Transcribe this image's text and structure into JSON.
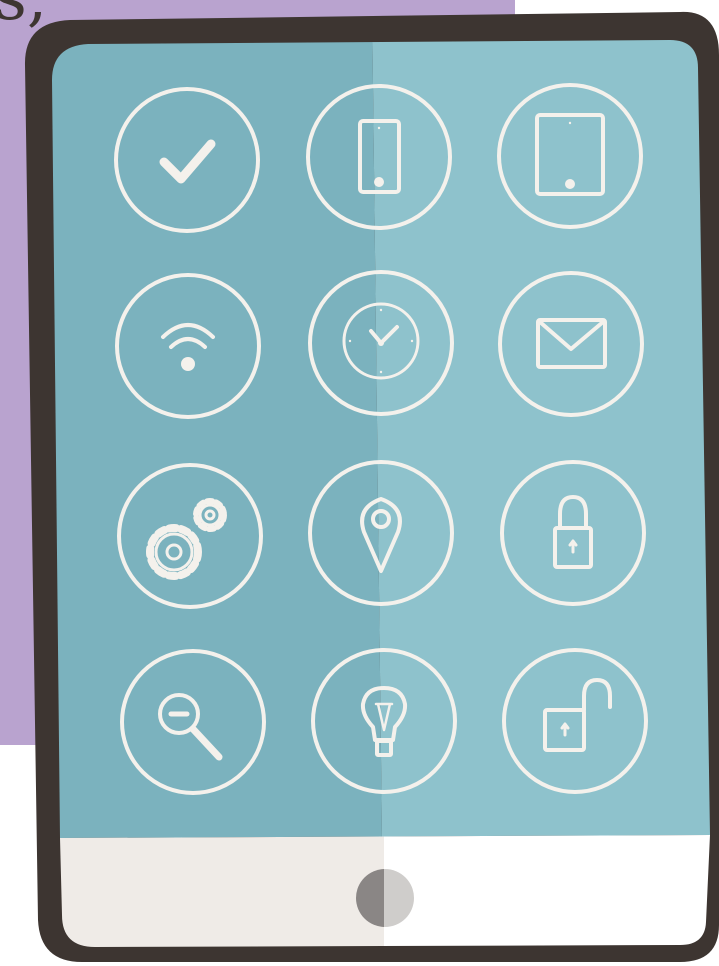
{
  "background_text": "s,",
  "colors": {
    "purple_background": "#b9a3cf",
    "tablet_frame": "#3d3531",
    "screen_left": "#7bb2be",
    "screen_right": "#8ec2cc",
    "bezel_left": "#efebe7",
    "bezel_right": "#ffffff",
    "icon_stroke": "#f4f1ec",
    "home_button_left": "#8a8685",
    "home_button_right": "#cfcdcb"
  },
  "icons": [
    "checkmark-icon",
    "phone-icon",
    "tablet-icon",
    "wifi-icon",
    "clock-icon",
    "envelope-icon",
    "gears-icon",
    "location-pin-icon",
    "lock-icon",
    "zoom-out-icon",
    "lightbulb-icon",
    "unlock-icon"
  ]
}
